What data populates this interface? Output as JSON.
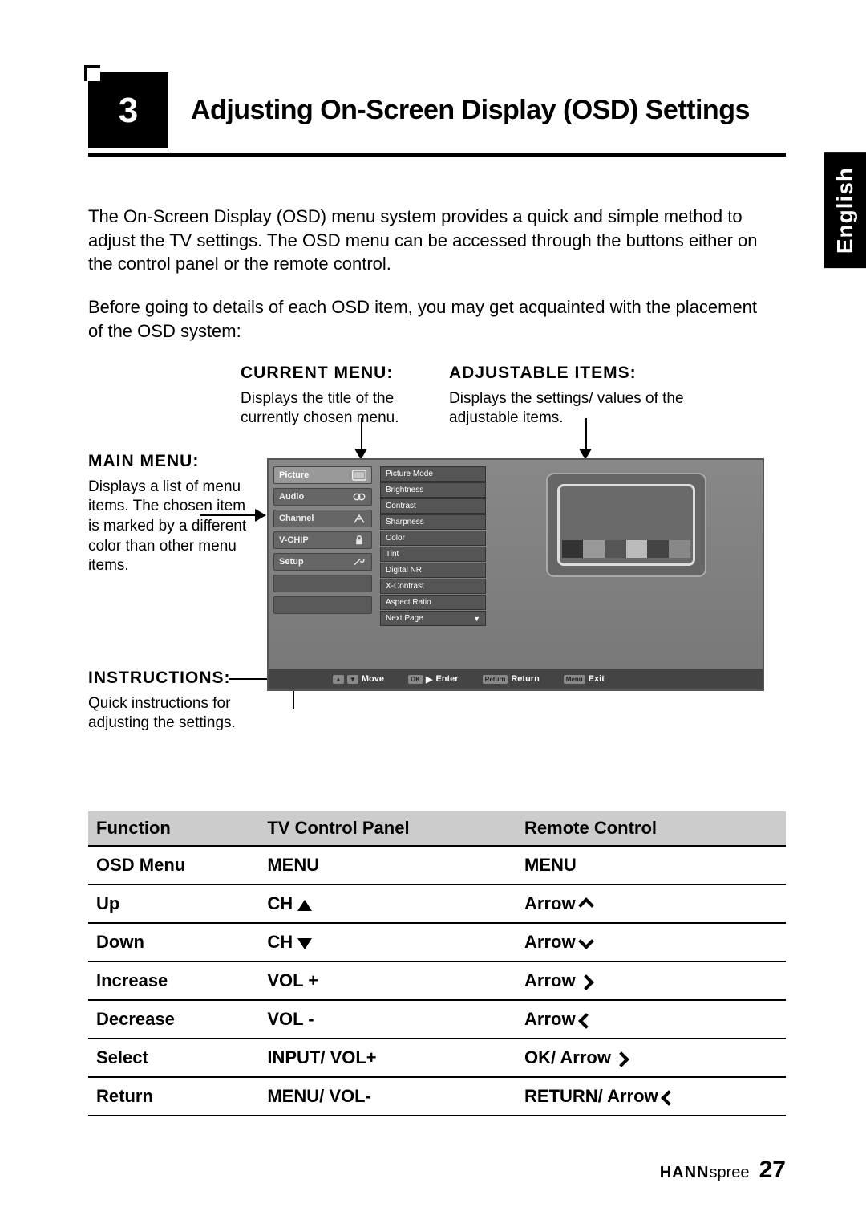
{
  "chapter": {
    "number": "3",
    "title": "Adjusting On-Screen Display (OSD) Settings"
  },
  "language_tab": "English",
  "paragraphs": {
    "p1": "The On-Screen Display (OSD) menu system provides a quick and simple method to adjust the TV settings. The OSD menu can be accessed through the buttons either on the control panel or the remote control.",
    "p2": "Before going to details of each OSD item, you may get acquainted with the placement of the OSD system:"
  },
  "callouts": {
    "current_menu": {
      "title": "CURRENT MENU:",
      "text": "Displays the title of the currently chosen menu."
    },
    "adjustable_items": {
      "title": "ADJUSTABLE ITEMS:",
      "text": "Displays the settings/ values of the adjustable items."
    },
    "main_menu": {
      "title": "MAIN MENU:",
      "text": "Displays a list of menu items. The chosen item is marked by a different color than other menu items."
    },
    "instructions": {
      "title": "INSTRUCTIONS:",
      "text": "Quick instructions for adjusting the settings."
    }
  },
  "osd": {
    "main_items": [
      "Picture",
      "Audio",
      "Channel",
      "V-CHIP",
      "Setup"
    ],
    "adjustable": [
      "Picture Mode",
      "Brightness",
      "Contrast",
      "Sharpness",
      "Color",
      "Tint",
      "Digital NR",
      "X-Contrast",
      "Aspect Ratio",
      "Next Page"
    ],
    "instructions_bar": {
      "move": "Move",
      "enter": "Enter",
      "return": "Return",
      "exit": "Exit"
    }
  },
  "table": {
    "headers": {
      "function": "Function",
      "panel": "TV Control Panel",
      "remote": "Remote Control"
    },
    "rows": [
      {
        "function": "OSD Menu",
        "panel": "MENU",
        "remote": "MENU",
        "panel_icon": "",
        "remote_icon": ""
      },
      {
        "function": "Up",
        "panel": "CH",
        "remote": "Arrow",
        "panel_icon": "tri-up",
        "remote_icon": "chev-up"
      },
      {
        "function": "Down",
        "panel": "CH",
        "remote": "Arrow",
        "panel_icon": "tri-down",
        "remote_icon": "chev-down"
      },
      {
        "function": "Increase",
        "panel": "VOL +",
        "remote": "Arrow",
        "panel_icon": "",
        "remote_icon": "chev-right"
      },
      {
        "function": "Decrease",
        "panel": "VOL -",
        "remote": "Arrow",
        "panel_icon": "",
        "remote_icon": "chev-left"
      },
      {
        "function": "Select",
        "panel": "INPUT/ VOL+",
        "remote": "OK/ Arrow",
        "panel_icon": "",
        "remote_icon": "chev-right"
      },
      {
        "function": "Return",
        "panel": "MENU/ VOL-",
        "remote": "RETURN/ Arrow",
        "panel_icon": "",
        "remote_icon": "chev-left"
      }
    ]
  },
  "footer": {
    "brand1": "HANN",
    "brand2": "spree",
    "page": "27"
  }
}
